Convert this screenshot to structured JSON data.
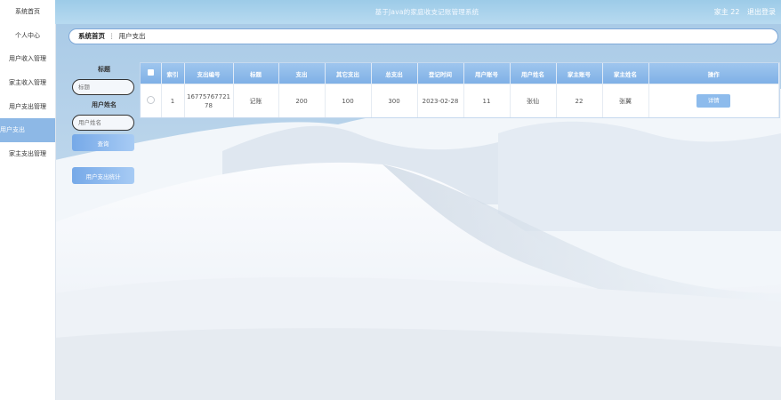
{
  "app": {
    "title": "基于Java的家庭收支记账管理系统"
  },
  "user": {
    "label": "家主 22",
    "logout": "退出登录"
  },
  "sidebar": {
    "items": [
      {
        "label": "系统首页"
      },
      {
        "label": "个人中心"
      },
      {
        "label": "用户收入管理"
      },
      {
        "label": "家主收入管理"
      },
      {
        "label": "用户支出管理"
      },
      {
        "label": "用户支出"
      },
      {
        "label": "家主支出管理"
      }
    ]
  },
  "breadcrumb": {
    "home": "系统首页",
    "separator": "⋮",
    "current": "用户支出"
  },
  "search": {
    "title_label": "标题",
    "title_placeholder": "标题",
    "name_label": "用户姓名",
    "name_placeholder": "用户姓名",
    "query_button": "查询",
    "stats_button": "用户支出统计"
  },
  "table": {
    "headers": [
      "索引",
      "支出编号",
      "标题",
      "支出",
      "其它支出",
      "总支出",
      "登记时间",
      "用户账号",
      "用户姓名",
      "家主账号",
      "家主姓名",
      "操作"
    ],
    "rows": [
      {
        "index": "1",
        "number": "1677576772178",
        "title": "记账",
        "expense": "200",
        "other": "100",
        "total": "300",
        "date": "2023-02-28",
        "account": "11",
        "name": "张仙",
        "owner_account": "22",
        "owner_name": "张翼",
        "action": "详情"
      }
    ]
  }
}
